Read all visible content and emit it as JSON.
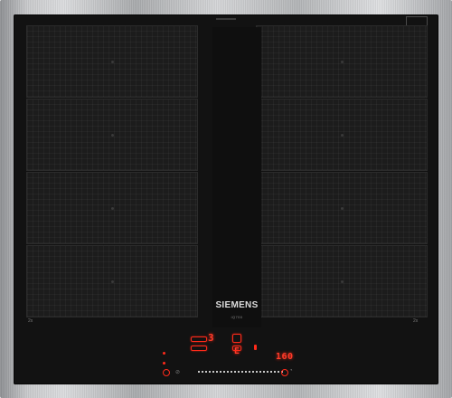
{
  "brand": "SIEMENS",
  "series": "iQ700",
  "left_label": "2x",
  "right_label": "2x",
  "display_left": "3",
  "display_right": "160",
  "colors": {
    "frame": "#c8c9cb",
    "glass": "#121212",
    "indicator": "#ff2a1a"
  },
  "icons": {
    "power": "power-icon",
    "timer": "timer-icon",
    "slider": "slider-icon"
  }
}
